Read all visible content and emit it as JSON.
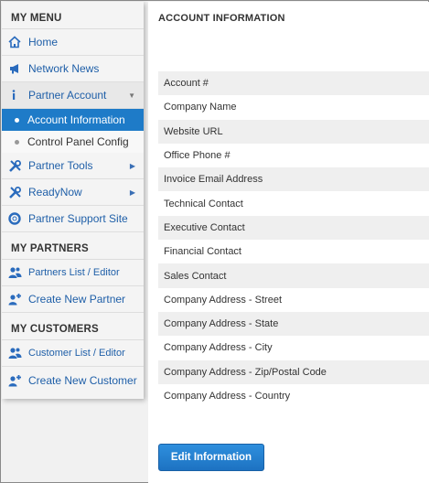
{
  "sidebar": {
    "my_menu": {
      "heading": "MY MENU",
      "items": [
        {
          "label": "Home",
          "icon": "home-icon"
        },
        {
          "label": "Network News",
          "icon": "megaphone-icon"
        },
        {
          "label": "Partner Account",
          "icon": "info-icon",
          "expanded": true,
          "children": [
            {
              "label": "Account Information",
              "active": true
            },
            {
              "label": "Control Panel Config",
              "active": false
            }
          ]
        },
        {
          "label": "Partner Tools",
          "icon": "tools-icon"
        },
        {
          "label": "ReadyNow",
          "icon": "tools-icon"
        },
        {
          "label": "Partner Support Site",
          "icon": "lifebuoy-icon"
        }
      ]
    },
    "my_partners": {
      "heading": "MY PARTNERS",
      "items": [
        {
          "label": "Partners List / Editor",
          "icon": "users-icon"
        },
        {
          "label": "Create New Partner",
          "icon": "add-user-icon"
        }
      ]
    },
    "my_customers": {
      "heading": "MY CUSTOMERS",
      "items": [
        {
          "label": "Customer List / Editor",
          "icon": "users-icon"
        },
        {
          "label": "Create New Customer",
          "icon": "add-user-icon"
        }
      ]
    }
  },
  "main": {
    "title": "ACCOUNT INFORMATION",
    "fields": [
      "Account #",
      "Company Name",
      "Website URL",
      "Office Phone #",
      "Invoice Email Address",
      "Technical Contact",
      "Executive Contact",
      "Financial Contact",
      "Sales Contact",
      "Company Address - Street",
      "Company Address - State",
      "Company Address - City",
      "Company Address - Zip/Postal Code",
      "Company Address - Country"
    ],
    "edit_button": "Edit Information"
  },
  "colors": {
    "accent": "#1e7bc8",
    "link": "#1f5fa8"
  }
}
